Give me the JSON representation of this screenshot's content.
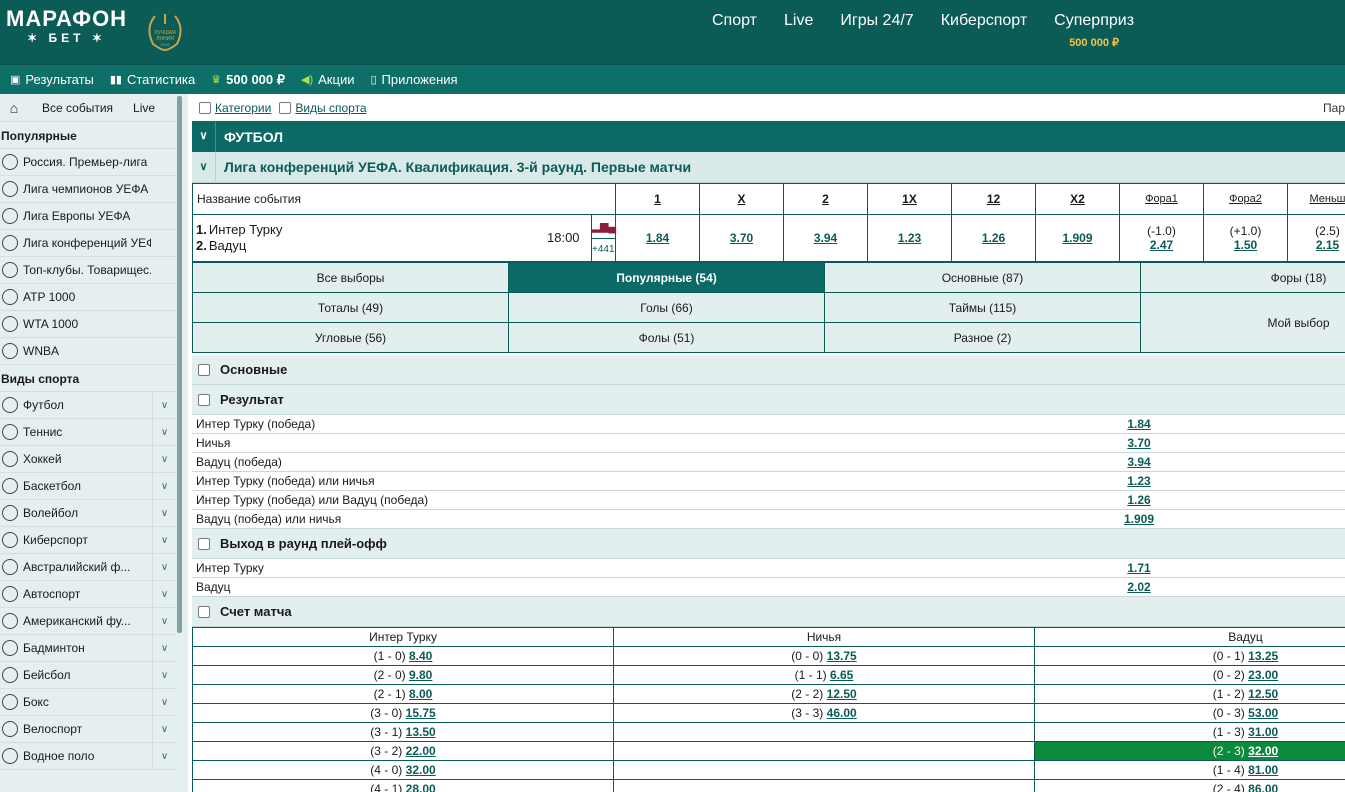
{
  "header": {
    "logo_line1": "МАРАФОН",
    "logo_line2": "БЕТ",
    "laurel_text": "ЛУЧШАЯ ЛИНИЯ 2019",
    "nav": [
      {
        "label": "Спорт"
      },
      {
        "label": "Live"
      },
      {
        "label": "Игры 24/7"
      },
      {
        "label": "Киберспорт"
      },
      {
        "label": "Суперприз",
        "sub": "500 000 ₽"
      }
    ],
    "accent": "#0b5b57",
    "gold": "#f6c343"
  },
  "subnav": [
    {
      "icon": "results-icon",
      "label": "Результаты"
    },
    {
      "icon": "stats-icon",
      "label": "Статистика"
    },
    {
      "icon": "prize-icon",
      "label": "500 000 ₽"
    },
    {
      "icon": "megaphone-icon",
      "label": "Акции"
    },
    {
      "icon": "phone-icon",
      "label": "Приложения"
    }
  ],
  "sidebar": {
    "all_events": "Все события",
    "live": "Live",
    "popular_title": "Популярные",
    "popular": [
      "Россия. Премьер-лига",
      "Лига чемпионов УЕФА",
      "Лига Европы УЕФА",
      "Лига конференций УЕФА",
      "Топ-клубы. Товарищес...",
      "ATP 1000",
      "WTA 1000",
      "WNBA"
    ],
    "sports_title": "Виды спорта",
    "sports": [
      "Футбол",
      "Теннис",
      "Хоккей",
      "Баскетбол",
      "Волейбол",
      "Киберспорт",
      "Австралийский ф...",
      "Автоспорт",
      "Американский фу...",
      "Бадминтон",
      "Бейсбол",
      "Бокс",
      "Велоспорт",
      "Водное поло"
    ]
  },
  "filters": {
    "categories": "Категории",
    "sports": "Виды спорта",
    "right_cut": "Пар"
  },
  "sport_header": "ФУТБОЛ",
  "league_header": "Лига конференций УЕФА. Квалификация. 3-й раунд. Первые матчи",
  "odds_table": {
    "col_event": "Название события",
    "cols": [
      "1",
      "X",
      "2",
      "1X",
      "12",
      "X2",
      "Фора1",
      "Фора2",
      "Меньш"
    ],
    "team1_num": "1.",
    "team1": "Интер Турку",
    "team2_num": "2.",
    "team2": "Вадуц",
    "time": "18:00",
    "more": "+441",
    "odds": [
      "1.84",
      "3.70",
      "3.94",
      "1.23",
      "1.26",
      "1.909"
    ],
    "fora1_line": "(-1.0)",
    "fora1": "2.47",
    "fora2_line": "(+1.0)",
    "fora2": "1.50",
    "under_line": "(2.5)",
    "under": "2.15"
  },
  "tabs": {
    "row1": [
      "Все выборы",
      "Популярные (54)",
      "Основные (87)",
      "Форы (18)"
    ],
    "row2": [
      "Тоталы (49)",
      "Голы (66)",
      "Таймы (115)"
    ],
    "row3": [
      "Угловые (56)",
      "Фолы (51)",
      "Разное (2)"
    ],
    "my_choice": "Мой выбор"
  },
  "sections": {
    "main": "Основные",
    "result": "Результат",
    "playoff": "Выход в раунд плей-офф",
    "score": "Счет матча"
  },
  "result_rows": [
    {
      "name": "Интер Турку (победа)",
      "odd": "1.84"
    },
    {
      "name": "Ничья",
      "odd": "3.70"
    },
    {
      "name": "Вадуц (победа)",
      "odd": "3.94"
    },
    {
      "name": "Интер Турку (победа) или ничья",
      "odd": "1.23"
    },
    {
      "name": "Интер Турку (победа) или Вадуц (победа)",
      "odd": "1.26"
    },
    {
      "name": "Вадуц (победа) или ничья",
      "odd": "1.909"
    }
  ],
  "playoff_rows": [
    {
      "name": "Интер Турку",
      "odd": "1.71"
    },
    {
      "name": "Вадуц",
      "odd": "2.02"
    }
  ],
  "correct_score": {
    "headers": [
      "Интер Турку",
      "Ничья",
      "Вадуц"
    ],
    "rows": [
      [
        {
          "s": "(1 - 0)",
          "o": "8.40"
        },
        {
          "s": "(0 - 0)",
          "o": "13.75"
        },
        {
          "s": "(0 - 1)",
          "o": "13.25"
        }
      ],
      [
        {
          "s": "(2 - 0)",
          "o": "9.80"
        },
        {
          "s": "(1 - 1)",
          "o": "6.65"
        },
        {
          "s": "(0 - 2)",
          "o": "23.00"
        }
      ],
      [
        {
          "s": "(2 - 1)",
          "o": "8.00"
        },
        {
          "s": "(2 - 2)",
          "o": "12.50"
        },
        {
          "s": "(1 - 2)",
          "o": "12.50"
        }
      ],
      [
        {
          "s": "(3 - 0)",
          "o": "15.75"
        },
        {
          "s": "(3 - 3)",
          "o": "46.00"
        },
        {
          "s": "(0 - 3)",
          "o": "53.00"
        }
      ],
      [
        {
          "s": "(3 - 1)",
          "o": "13.50"
        },
        null,
        {
          "s": "(1 - 3)",
          "o": "31.00"
        }
      ],
      [
        {
          "s": "(3 - 2)",
          "o": "22.00"
        },
        null,
        {
          "s": "(2 - 3)",
          "o": "32.00",
          "hl": true
        }
      ],
      [
        {
          "s": "(4 - 0)",
          "o": "32.00"
        },
        null,
        {
          "s": "(1 - 4)",
          "o": "81.00"
        }
      ],
      [
        {
          "s": "(4 - 1)",
          "o": "28.00"
        },
        null,
        {
          "s": "(2 - 4)",
          "o": "86.00"
        }
      ]
    ]
  }
}
